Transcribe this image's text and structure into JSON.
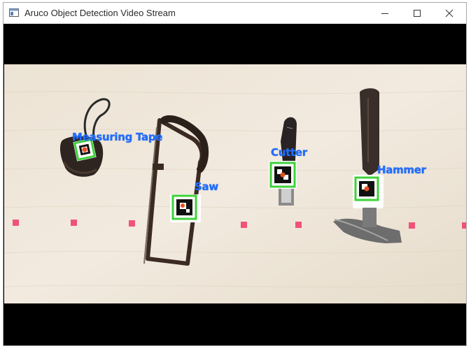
{
  "window": {
    "title": "Aruco Object Detection Video Stream",
    "icon": "app-window-icon",
    "controls": [
      "minimize-icon",
      "maximize-icon",
      "close-icon"
    ]
  },
  "video": {
    "detections": [
      {
        "label": "Measuring Tape",
        "marker_color": "#3fd13a"
      },
      {
        "label": "Saw",
        "marker_color": "#3fd13a"
      },
      {
        "label": "Cutter",
        "marker_color": "#3fd13a"
      },
      {
        "label": "Hammer",
        "marker_color": "#3fd13a"
      }
    ],
    "label_color": "#1f6dff",
    "surface_color": "#efe6d8",
    "tape_mark_color": "#f0527a"
  }
}
